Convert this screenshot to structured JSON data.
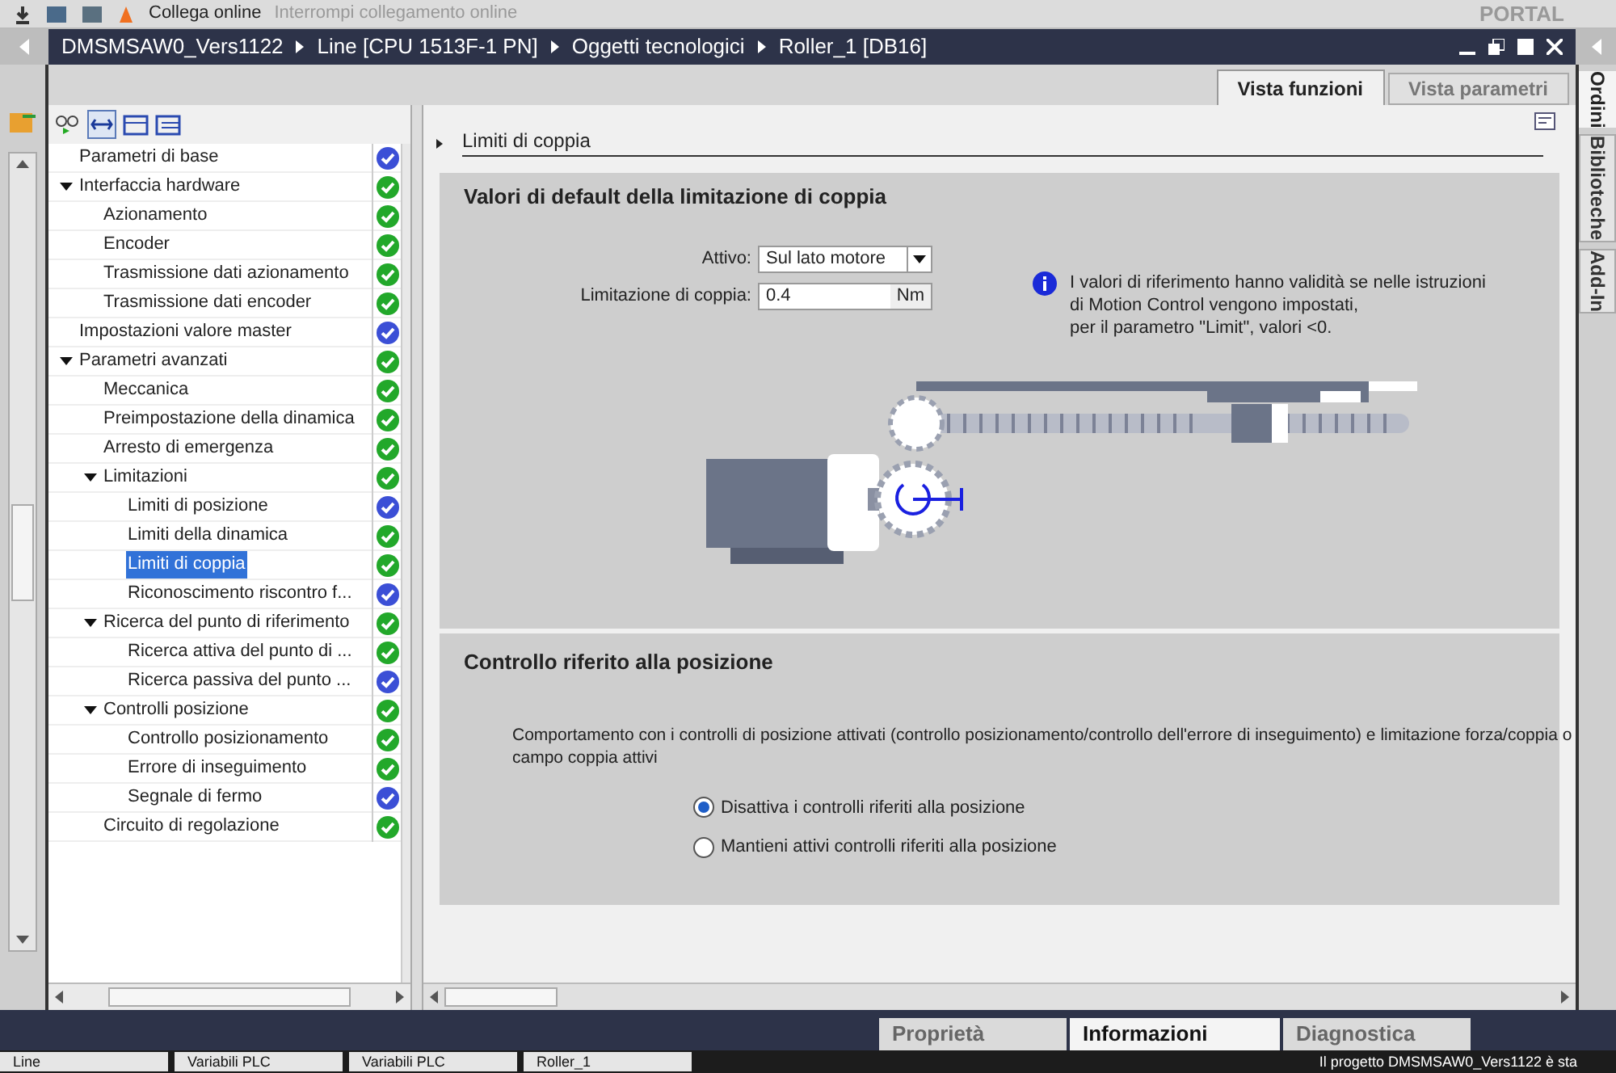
{
  "toolbar": {
    "connect": "Collega online",
    "disconnect": "Interrompi collegamento online",
    "brand": "PORTAL"
  },
  "breadcrumb": [
    "DMSMSAW0_Vers1122",
    "Line [CPU 1513F-1 PN]",
    "Oggetti tecnologici",
    "Roller_1 [DB16]"
  ],
  "tabs": [
    {
      "label": "Vista funzioni",
      "selected": true
    },
    {
      "label": "Vista parametri",
      "selected": false
    }
  ],
  "tree": [
    {
      "label": "Parametri di base",
      "color": "#3b4fd6",
      "selected": false
    },
    {
      "label": "Interfaccia hardware",
      "color": "#22a82a",
      "selected": false,
      "expanded": true,
      "children": [
        {
          "label": "Azionamento",
          "color": "#22a82a",
          "selected": false
        },
        {
          "label": "Encoder",
          "color": "#22a82a",
          "selected": false
        },
        {
          "label": "Trasmissione dati azionamento",
          "color": "#22a82a",
          "selected": false
        },
        {
          "label": "Trasmissione dati encoder",
          "color": "#22a82a",
          "selected": false
        }
      ]
    },
    {
      "label": "Impostazioni valore master",
      "color": "#3b4fd6",
      "selected": false
    },
    {
      "label": "Parametri avanzati",
      "color": "#22a82a",
      "selected": false,
      "expanded": true,
      "children": [
        {
          "label": "Meccanica",
          "color": "#22a82a",
          "selected": false
        },
        {
          "label": "Preimpostazione della dinamica",
          "color": "#22a82a",
          "selected": false
        },
        {
          "label": "Arresto di emergenza",
          "color": "#22a82a",
          "selected": false
        },
        {
          "label": "Limitazioni",
          "color": "#22a82a",
          "selected": false,
          "expanded": true,
          "children": [
            {
              "label": "Limiti di posizione",
              "color": "#3b4fd6",
              "selected": false
            },
            {
              "label": "Limiti della dinamica",
              "color": "#22a82a",
              "selected": false
            },
            {
              "label": "Limiti di coppia",
              "color": "#22a82a",
              "selected": true
            },
            {
              "label": "Riconoscimento riscontro f...",
              "color": "#3b4fd6",
              "selected": false
            }
          ]
        },
        {
          "label": "Ricerca del punto di riferimento",
          "color": "#22a82a",
          "selected": false,
          "expanded": true,
          "children": [
            {
              "label": "Ricerca attiva del punto di ...",
              "color": "#22a82a",
              "selected": false
            },
            {
              "label": "Ricerca passiva del punto ...",
              "color": "#3b4fd6",
              "selected": false
            }
          ]
        },
        {
          "label": "Controlli posizione",
          "color": "#22a82a",
          "selected": false,
          "expanded": true,
          "children": [
            {
              "label": "Controllo posizionamento",
              "color": "#22a82a",
              "selected": false
            },
            {
              "label": "Errore di inseguimento",
              "color": "#22a82a",
              "selected": false
            },
            {
              "label": "Segnale di fermo",
              "color": "#3b4fd6",
              "selected": false
            }
          ]
        },
        {
          "label": "Circuito di regolazione",
          "color": "#22a82a",
          "selected": false
        }
      ]
    }
  ],
  "page_title": "Limiti di coppia",
  "section1": {
    "title": "Valori di default della limitazione di coppia",
    "active_label": "Attivo:",
    "active_value": "Sul lato motore",
    "limit_label": "Limitazione di coppia:",
    "limit_value": "0.4",
    "limit_unit": "Nm",
    "info": [
      "I valori di riferimento hanno validità se nelle istruzioni",
      "di Motion Control vengono impostati,",
      "per il parametro \"Limit\", valori <0."
    ]
  },
  "section2": {
    "title": "Controllo riferito alla posizione",
    "description": "Comportamento con i controlli di posizione attivati (controllo posizionamento/controllo dell'errore di inseguimento) e limitazione forza/coppia o campo coppia attivi",
    "options": [
      {
        "label": "Disattiva i controlli riferiti alla posizione",
        "selected": true
      },
      {
        "label": "Mantieni attivi controlli riferiti alla posizione",
        "selected": false
      }
    ]
  },
  "side_tabs": [
    {
      "label": "Ordini",
      "selected": true
    },
    {
      "label": "Biblioteche",
      "selected": false
    },
    {
      "label": "Add-In",
      "selected": false
    }
  ],
  "bottom_tabs": [
    {
      "label": "Proprietà",
      "selected": false
    },
    {
      "label": "Informazioni",
      "selected": true
    },
    {
      "label": "Diagnostica",
      "selected": false
    }
  ],
  "taskbar": [
    "Line",
    "Variabili PLC",
    "Variabili PLC",
    "Roller_1"
  ],
  "status_message": "Il progetto DMSMSAW0_Vers1122 è sta"
}
